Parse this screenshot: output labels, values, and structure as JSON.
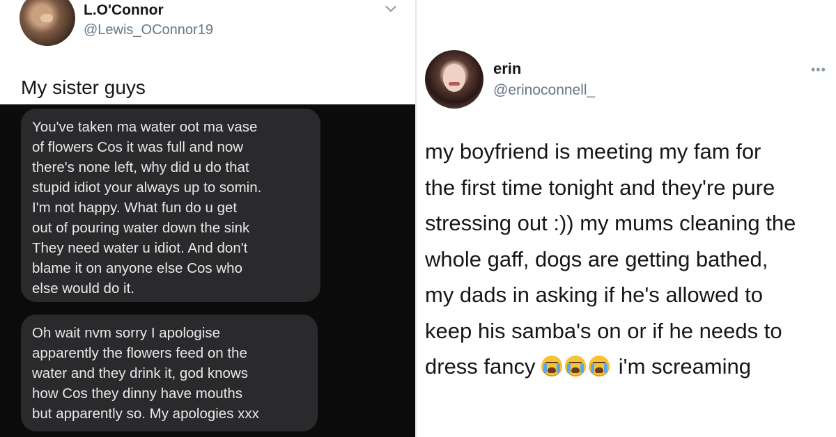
{
  "left_tweet": {
    "display_name": "L.O'Connor",
    "handle": "@Lewis_OConnor19",
    "text": "My sister guys",
    "messages": [
      {
        "lines": [
          "You've taken ma water oot ma vase",
          "of flowers Cos it was full and now",
          "there's none left, why did u do that",
          "stupid idiot your always up to somin.",
          "I'm not happy. What fun do u get",
          "out of pouring water down the sink",
          "They need water u idiot. And don't",
          "blame it on anyone else Cos who",
          "else would do it."
        ]
      },
      {
        "lines": [
          "Oh wait nvm sorry I apologise",
          "apparently the flowers feed on the",
          "water and they drink it, god knows",
          "how Cos they dinny have mouths",
          "but apparently so. My apologies xxx"
        ]
      }
    ]
  },
  "right_tweet": {
    "display_name": "erin",
    "handle": "@erinoconnell_",
    "more_label": "•••",
    "lines": [
      "my boyfriend is meeting my fam for",
      "the first time tonight and they're pure",
      "stressing out :)) my mums cleaning the",
      "whole gaff, dogs are getting bathed,",
      "my dads in asking if he's allowed to",
      "keep his samba's on or if he needs to"
    ],
    "last_line_start": "dress fancy",
    "last_line_end": "i'm screaming",
    "emojis": [
      "loudly-crying-face",
      "loudly-crying-face",
      "loudly-crying-face"
    ]
  },
  "colors": {
    "name_text": "#14171a",
    "handle_text": "#657786",
    "bubble_bg": "#2a2a2c",
    "screenshot_bg": "#0b0b0c"
  }
}
